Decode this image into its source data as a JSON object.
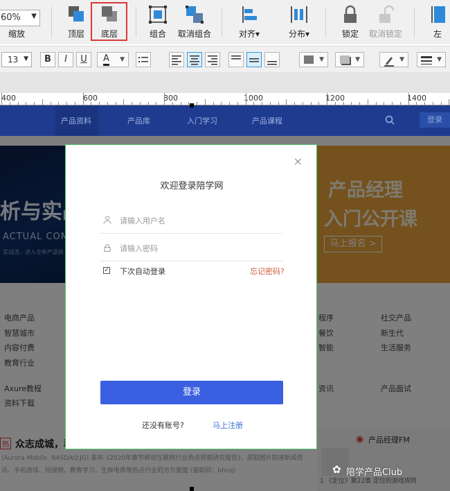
{
  "toolbar": {
    "zoom_value": "60%",
    "zoom_label": "缩放",
    "tools": [
      "顶层",
      "底层",
      "组合",
      "取消组合",
      "对齐",
      "分布",
      "锁定",
      "取消锁定",
      "左"
    ],
    "align_arrow": "▾",
    "distribute_arrow": "▾"
  },
  "format_bar": {
    "font_size": "13",
    "bold": "B",
    "italic": "I",
    "underline": "U",
    "font_color_glyph": "A"
  },
  "ruler": {
    "labels": [
      "400",
      "600",
      "800",
      "1000",
      "1200",
      "1400"
    ]
  },
  "site": {
    "nav": [
      "产品资料",
      "产品库",
      "入门学习",
      "产品课程"
    ],
    "login": "登录",
    "banner_left": {
      "title": "析与实战",
      "subtitle": "ACTUAL COMBA",
      "small": "实战活，进入全新产品体"
    },
    "banner_right": {
      "line1": "产品经理",
      "line2": "入门公开课",
      "cta": "马上报名 >"
    },
    "categories_left": [
      "电商产品",
      "智慧城市",
      "内容付费",
      "教育行业",
      "Axure教程",
      "资料下载"
    ],
    "categories_mid": [
      "程序",
      "餐饮",
      "智能",
      "资讯"
    ],
    "categories_right": [
      "社交产品",
      "新生代",
      "生活服务",
      "产品面试"
    ],
    "news_tag": "热",
    "news_title": "众志成城，移",
    "news_body": "(Aurora Mobile, NASDAQ:JG) 发布《2020年春节移动互联网行业热点观察研究报告》，提取图片知道新闻资讯、手机游戏、短视频、教育学习、生鲜电商等热点行业的方方面面 (报取码：bhcq)",
    "fm_title": "产品经理FM",
    "fm_episode": "1 《定位》第22章 定位的游戏规则"
  },
  "modal": {
    "close": "×",
    "title": "欢迎登录陪学网",
    "username_placeholder": "请输入用户名",
    "password_placeholder": "请输入密码",
    "remember": "下次自动登录",
    "forgot": "忘记密码?",
    "submit": "登录",
    "no_account": "还没有账号?",
    "register": "马上注册"
  },
  "watermark": "陪学产品Club",
  "colors": {
    "highlight": "#d9393a",
    "nav_bg": "#1f3b8f",
    "submit_bg": "#3a5fe0",
    "register_link": "#3a72d6",
    "forgot_link": "#d05a3a"
  }
}
